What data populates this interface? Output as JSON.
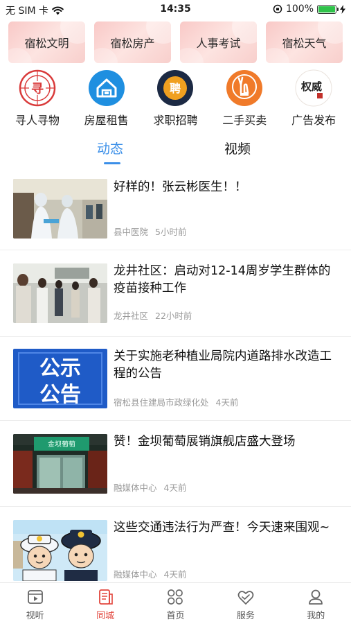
{
  "status_bar": {
    "carrier": "无 SIM 卡",
    "time": "14:35",
    "battery": "100%",
    "battery_level": 1.0
  },
  "channels": [
    "宿松文明",
    "宿松房产",
    "人事考试",
    "宿松天气"
  ],
  "services": [
    {
      "label": "寻人寻物",
      "icon": "find-person-icon",
      "glyph": "寻",
      "color": "#d93a3a"
    },
    {
      "label": "房屋租售",
      "icon": "house-icon",
      "glyph": "",
      "color": "#1f8fe0"
    },
    {
      "label": "求职招聘",
      "icon": "recruit-icon",
      "glyph": "聘",
      "color": "#1c2a44"
    },
    {
      "label": "二手买卖",
      "icon": "second-hand-icon",
      "glyph": "",
      "color": "#f07a2a"
    },
    {
      "label": "广告发布",
      "icon": "ad-publish-icon",
      "glyph": "权威",
      "color": "#c2302a"
    }
  ],
  "tabs": {
    "active": "动态",
    "video": "视频"
  },
  "feed": [
    {
      "title": "好样的！张云彬医生！！",
      "source": "县中医院",
      "time": "5小时前",
      "thumb": "medical-workers-photo"
    },
    {
      "title": "龙井社区：启动对12-14周岁学生群体的疫苗接种工作",
      "source": "龙井社区",
      "time": "22小时前",
      "thumb": "vaccination-crowd-photo"
    },
    {
      "title": "关于实施老种植业局院内道路排水改造工程的公告",
      "source": "宿松县住建局市政绿化处",
      "time": "4天前",
      "thumb": "announcement-banner",
      "thumb_text": "公示公告"
    },
    {
      "title": "赞！金坝葡萄展销旗舰店盛大登场",
      "source": "融媒体中心",
      "time": "4天前",
      "thumb": "storefront-photo",
      "thumb_text": "金坝葡萄"
    },
    {
      "title": "这些交通违法行为严查！今天速来围观~",
      "source": "融媒体中心",
      "time": "4天前",
      "thumb": "traffic-police-cartoon"
    }
  ],
  "bottom_nav": [
    {
      "label": "视听",
      "icon": "video-play-icon"
    },
    {
      "label": "同城",
      "icon": "city-news-icon",
      "active": true
    },
    {
      "label": "首页",
      "icon": "home-grid-icon"
    },
    {
      "label": "服务",
      "icon": "service-heart-icon"
    },
    {
      "label": "我的",
      "icon": "profile-icon"
    }
  ],
  "colors": {
    "accent": "#3b8fe8",
    "nav_active": "#e2453c",
    "channel_bg": "#fbd6d3"
  }
}
